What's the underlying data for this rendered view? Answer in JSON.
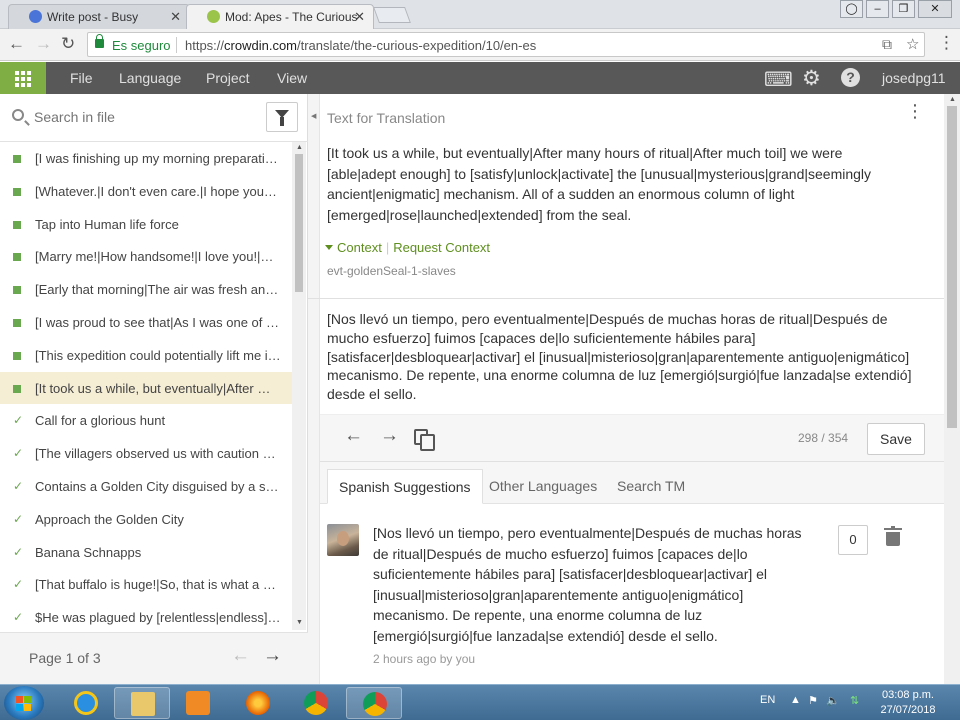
{
  "browser": {
    "tabs": [
      {
        "title": "Write post - Busy",
        "close": "✕"
      },
      {
        "title": "Mod: Apes - The Curious",
        "close": "✕"
      }
    ],
    "window_controls": [
      "–",
      "❐",
      "✕"
    ],
    "nav": {
      "back": "←",
      "forward": "→",
      "reload": "↻"
    },
    "address": {
      "secure_label": "Es seguro",
      "url_scheme": "https://",
      "url_host": "crowdin.com",
      "url_path": "/translate/the-curious-expedition/10/en-es"
    },
    "toolbar_icons": {
      "translate": "⧉",
      "star": "☆",
      "menu": "⋮"
    }
  },
  "menubar": {
    "items": [
      "File",
      "Language",
      "Project",
      "View"
    ],
    "username": "josedpg11",
    "icons": {
      "keyboard": "⌨",
      "settings": "⚙",
      "help": "?"
    }
  },
  "sidebar": {
    "search_placeholder": "Search in file",
    "strings": [
      {
        "text": "[I was finishing up my morning preparati…",
        "status": "saved"
      },
      {
        "text": "[Whatever.|I don't even care.|I hope you…",
        "status": "saved"
      },
      {
        "text": "Tap into Human life force",
        "status": "saved"
      },
      {
        "text": "[Marry me!|How handsome!|I love you!|…",
        "status": "saved"
      },
      {
        "text": "[Early that morning|The air was fresh an…",
        "status": "saved"
      },
      {
        "text": "[I was proud to see that|As I was one of t…",
        "status": "saved"
      },
      {
        "text": "[This expedition could potentially lift me i…",
        "status": "saved"
      },
      {
        "text": "[It took us a while, but eventually|After …",
        "status": "saved",
        "selected": true
      },
      {
        "text": "Call for a glorious hunt",
        "status": "approved"
      },
      {
        "text": "[The villagers observed us with caution a…",
        "status": "approved"
      },
      {
        "text": "Contains a Golden City disguised by a sh…",
        "status": "approved"
      },
      {
        "text": "Approach the Golden City",
        "status": "approved"
      },
      {
        "text": "Banana Schnapps",
        "status": "approved"
      },
      {
        "text": "[That buffalo is huge!|So, that is what a b…",
        "status": "approved"
      },
      {
        "text": "$He was plagued by [relentless|endless] …",
        "status": "approved"
      }
    ],
    "check_glyph": "✓",
    "pagination": {
      "label": "Page 1 of 3",
      "prev": "←",
      "next": "→"
    }
  },
  "editor": {
    "source_title": "Text for Translation",
    "source_text": "[It took us a while, but eventually|After many hours of ritual|After much toil] we were [able|adept enough] to [satisfy|unlock|activate] the [unusual|mysterious|grand|seemingly ancient|enigmatic] mechanism. All of a sudden an enormous column of light [emerged|rose|launched|extended] from the seal.",
    "context_label": "Context",
    "request_context_label": "Request Context",
    "string_id": "evt-goldenSeal-1-slaves",
    "translation": "[Nos llevó un tiempo, pero eventualmente|Después de muchas horas de ritual|Después de mucho esfuerzo] fuimos [capaces de|lo suficientemente hábiles para] [satisfacer|desbloquear|activar] el [inusual|misterioso|gran|aparentemente antiguo|enigmático] mecanismo. De repente, una enorme columna de luz [emergió|surgió|fue lanzada|se extendió] desde el sello.",
    "counter": "298 / 354",
    "save_label": "Save",
    "action_icons": {
      "prev": "←",
      "next": "→"
    }
  },
  "suggestions": {
    "tabs": [
      "Spanish Suggestions",
      "Other Languages",
      "Search TM"
    ],
    "active_tab": 0,
    "items": [
      {
        "text": "[Nos llevó un tiempo, pero eventualmente|Después de muchas horas de ritual|Después de mucho esfuerzo] fuimos [capaces de|lo suficientemente hábiles para] [satisfacer|desbloquear|activar] el [inusual|misterioso|gran|aparentemente antiguo|enigmático] mecanismo. De repente, una enorme columna de luz [emergió|surgió|fue lanzada|se extendió] desde el sello.",
        "meta": "2 hours ago by you",
        "votes": "0"
      }
    ]
  },
  "taskbar": {
    "language": "EN",
    "time": "03:08 p.m.",
    "date": "27/07/2018"
  },
  "colors": {
    "accent_green": "#7fae45",
    "menubar": "#585858",
    "selected_row": "#f5edd4",
    "secure_green": "#1f8a3b"
  }
}
